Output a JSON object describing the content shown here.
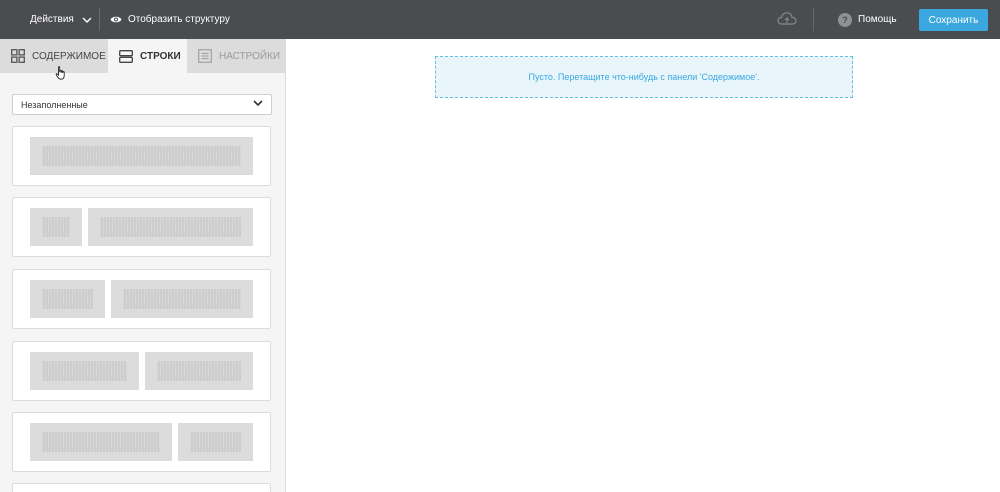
{
  "topbar": {
    "actions_label": "Действия",
    "structure_label": "Отобразить структуру",
    "help_label": "Помощь",
    "help_icon_glyph": "?",
    "save_label": "Сохранить"
  },
  "sidebar": {
    "tabs": [
      {
        "label": "Содержимое",
        "icon": "grid-icon",
        "state": "inactive"
      },
      {
        "label": "Строки",
        "icon": "rows-icon",
        "state": "active"
      },
      {
        "label": "Настройки",
        "icon": "settings-icon",
        "state": "disabled"
      }
    ],
    "filter": {
      "selected": "Незаполненные"
    },
    "row_layouts": [
      {
        "name": "one-column",
        "columns": 1
      },
      {
        "name": "narrow-wide",
        "columns": 2
      },
      {
        "name": "one-third-two-thirds",
        "columns": 2
      },
      {
        "name": "half-half",
        "columns": 2
      },
      {
        "name": "two-thirds-one-third",
        "columns": 2
      }
    ]
  },
  "canvas": {
    "empty_message": "Пусто. Перетащите что-нибудь с панели 'Содержимое'."
  },
  "colors": {
    "topbar_bg": "#4a4c50",
    "accent": "#3aa7e0",
    "dropzone_bg": "#e8f6fc"
  }
}
